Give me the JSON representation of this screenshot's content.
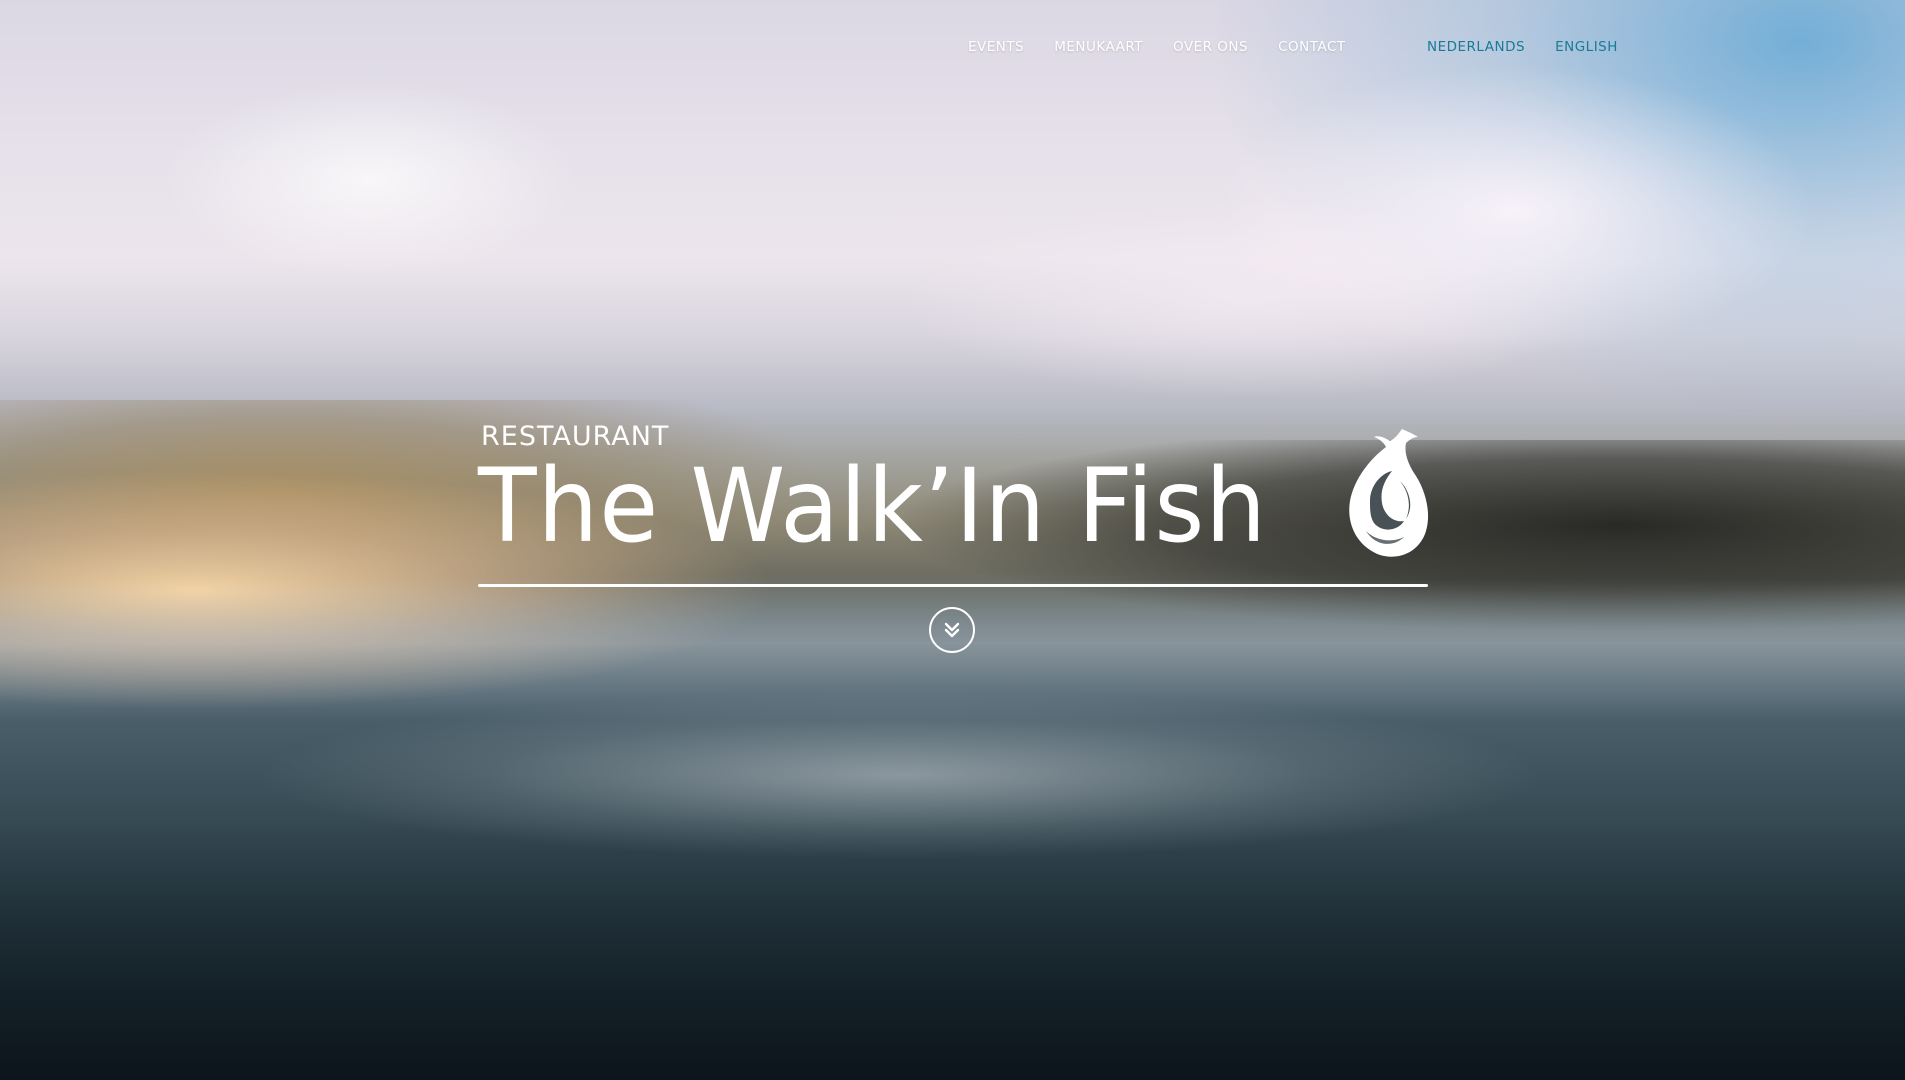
{
  "nav": {
    "items": [
      {
        "label": "EVENTS"
      },
      {
        "label": "MENUKAART"
      },
      {
        "label": "OVER ONS"
      },
      {
        "label": "CONTACT"
      }
    ]
  },
  "languages": {
    "items": [
      {
        "label": "NEDERLANDS"
      },
      {
        "label": "ENGLISH"
      }
    ],
    "color": "#1a7a96"
  },
  "hero": {
    "subtitle": "RESTAURANT",
    "title": "The Walk’In Fish",
    "logo_icon": "fish-hook-icon",
    "scroll_icon": "double-chevron-down-icon",
    "background": "blurred sea with clouds and hills"
  }
}
